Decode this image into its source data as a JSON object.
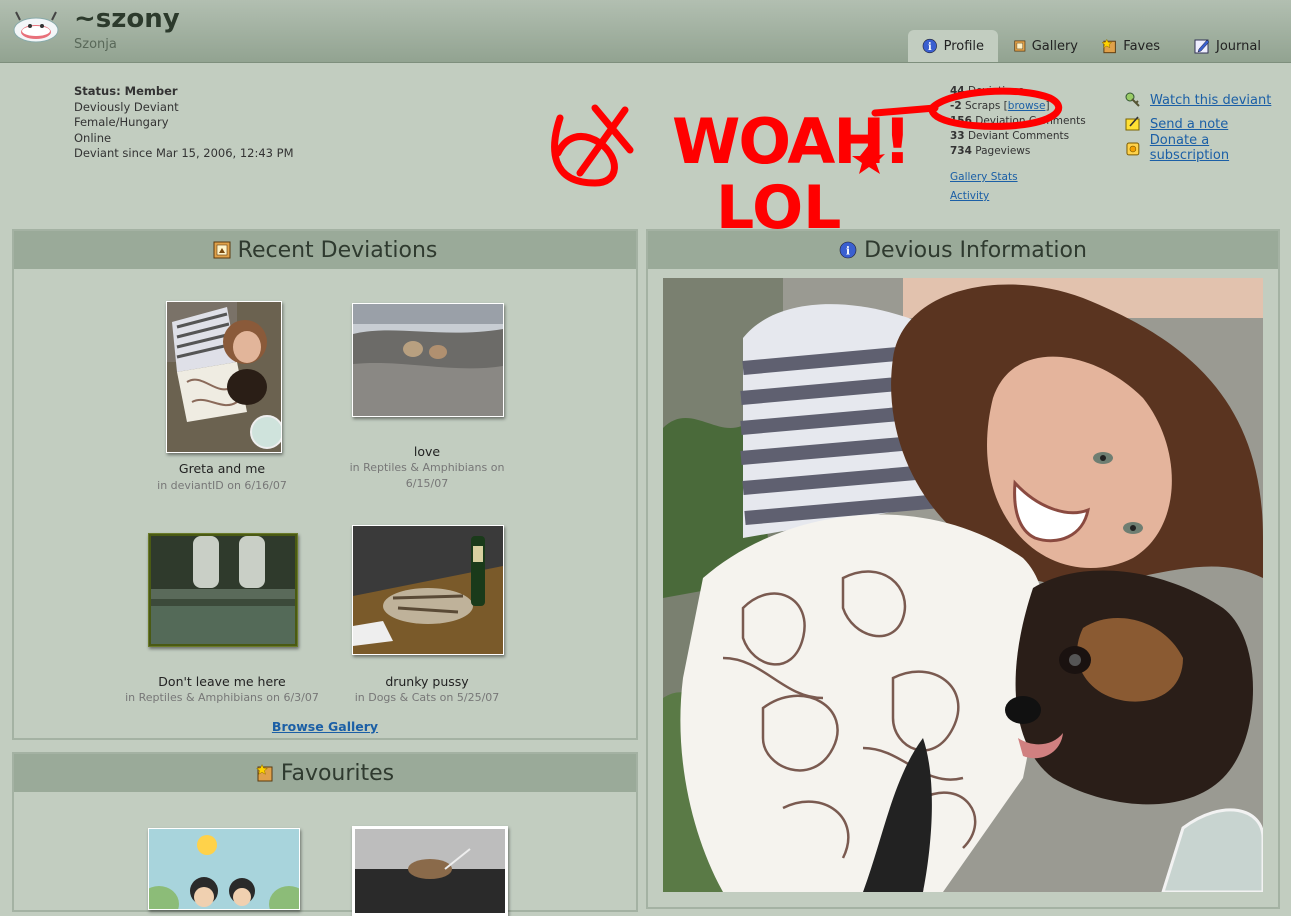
{
  "profile": {
    "username": "~szony",
    "real_name": "Szonja"
  },
  "tabs": [
    {
      "label": "Profile",
      "icon": "info-icon",
      "active": true
    },
    {
      "label": "Gallery",
      "icon": "gallery-icon",
      "active": false
    },
    {
      "label": "Faves",
      "icon": "faves-icon",
      "active": false
    },
    {
      "label": "Journal",
      "icon": "journal-icon",
      "active": false
    }
  ],
  "info": {
    "status": "Status: Member",
    "line1": "Deviously Deviant",
    "line2": "Female/Hungary",
    "line3": "Online",
    "line4": "Deviant since Mar 15, 2006, 12:43 PM"
  },
  "stats": {
    "deviations_num": "44",
    "deviations_label": "Deviations",
    "scraps_num": "-2",
    "scraps_label": "Scraps",
    "browse_link": "browse",
    "dev_comments_num": "156",
    "dev_comments_label": "Deviation Comments",
    "deviant_comments_num": "33",
    "deviant_comments_label": "Deviant Comments",
    "pageviews_num": "734",
    "pageviews_label": "Pageviews",
    "gallery_stats": "Gallery Stats",
    "activity": "Activity"
  },
  "actions": [
    {
      "label": "Watch this deviant",
      "icon": "watch-icon"
    },
    {
      "label": "Send a note",
      "icon": "note-icon"
    },
    {
      "label": "Donate a subscription",
      "icon": "donate-icon"
    }
  ],
  "doodle_text": {
    "line1": "WOAH!",
    "line2": "LOL"
  },
  "recent": {
    "title": "Recent Deviations",
    "items": [
      {
        "title": "Greta and me",
        "sub": "in deviantID on 6/16/07"
      },
      {
        "title": "love",
        "sub1": "in Reptiles & Amphibians on",
        "sub2": "6/15/07"
      },
      {
        "title": "Don't leave me here",
        "sub": "in Reptiles & Amphibians on 6/3/07"
      },
      {
        "title": "drunky pussy",
        "sub": "in Dogs & Cats on 5/25/07"
      }
    ],
    "browse": "Browse Gallery"
  },
  "favourites": {
    "title": "Favourites"
  },
  "devious": {
    "title": "Devious Information"
  },
  "colors": {
    "background": "#c2cdc0",
    "header": "#9aaa99",
    "link": "#1b5fa6",
    "doodle": "#ff0000"
  }
}
